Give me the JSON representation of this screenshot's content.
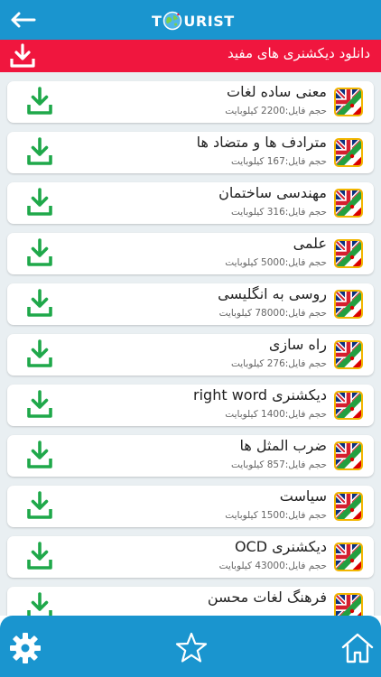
{
  "app": {
    "logo_left": "T",
    "logo_right": "URIST"
  },
  "banner": {
    "title": "دانلود دیکشنری های مفید"
  },
  "items": [
    {
      "title": "معنی ساده لغات",
      "size": "حجم فایل:2200 کیلوبایت"
    },
    {
      "title": "مترادف ها و متضاد ها",
      "size": "حجم فایل:167 کیلوبایت"
    },
    {
      "title": "مهندسی ساختمان",
      "size": "حجم فایل:316 کیلوبایت"
    },
    {
      "title": "علمی",
      "size": "حجم فایل:5000 کیلوبایت"
    },
    {
      "title": "روسی به انگلیسی",
      "size": "حجم فایل:78000 کیلوبایت"
    },
    {
      "title": "راه سازی",
      "size": "حجم فایل:276 کیلوبایت"
    },
    {
      "title": "دیکشنری right word",
      "size": "حجم فایل:1400 کیلوبایت"
    },
    {
      "title": "ضرب المثل ها",
      "size": "حجم فایل:857 کیلوبایت"
    },
    {
      "title": "سیاست",
      "size": "حجم فایل:1500 کیلوبایت"
    },
    {
      "title": "دیکشنری OCD",
      "size": "حجم فایل:43000 کیلوبایت"
    },
    {
      "title": "فرهنگ لغات محسن",
      "size": ""
    }
  ],
  "colors": {
    "header_blue": "#1a95cf",
    "banner_red": "#f0163e",
    "download_green": "#1fa84a",
    "list_background": "#e9eff2"
  },
  "icons": {
    "back": "arrow-left-icon",
    "banner": "download-icon",
    "item_action": "download-icon",
    "item_flag": "uk-iran-flag-icon",
    "nav": [
      "gear-icon",
      "star-icon",
      "home-icon"
    ]
  }
}
